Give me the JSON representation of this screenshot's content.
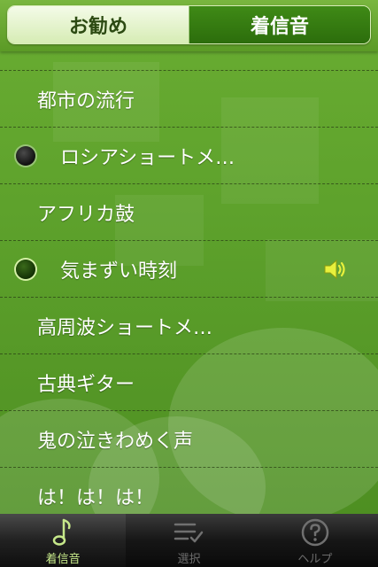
{
  "segmented": {
    "left_label": "お勧め",
    "right_label": "着信音"
  },
  "list": {
    "items": [
      {
        "label": "都市の流行",
        "radio": "none",
        "playing": false
      },
      {
        "label": "ロシアショートメ…",
        "radio": "dark",
        "playing": false
      },
      {
        "label": "アフリカ鼓",
        "radio": "none",
        "playing": false
      },
      {
        "label": "気まずい時刻",
        "radio": "green",
        "playing": true
      },
      {
        "label": "高周波ショートメ…",
        "radio": "none",
        "playing": false
      },
      {
        "label": "古典ギター",
        "radio": "none",
        "playing": false
      },
      {
        "label": "鬼の泣きわめく声",
        "radio": "none",
        "playing": false
      },
      {
        "label": "は！は！は！",
        "radio": "none",
        "playing": false
      }
    ]
  },
  "tabbar": {
    "tabs": [
      {
        "label": "着信音",
        "icon": "music-note-icon",
        "active": true
      },
      {
        "label": "選択",
        "icon": "checklist-icon",
        "active": false
      },
      {
        "label": "ヘルプ",
        "icon": "help-icon",
        "active": false
      }
    ]
  },
  "colors": {
    "accent_green": "#2c6d0c",
    "background_green": "#5ea22c",
    "tab_active": "#c6e88a",
    "speaker": "#e8f03c"
  }
}
